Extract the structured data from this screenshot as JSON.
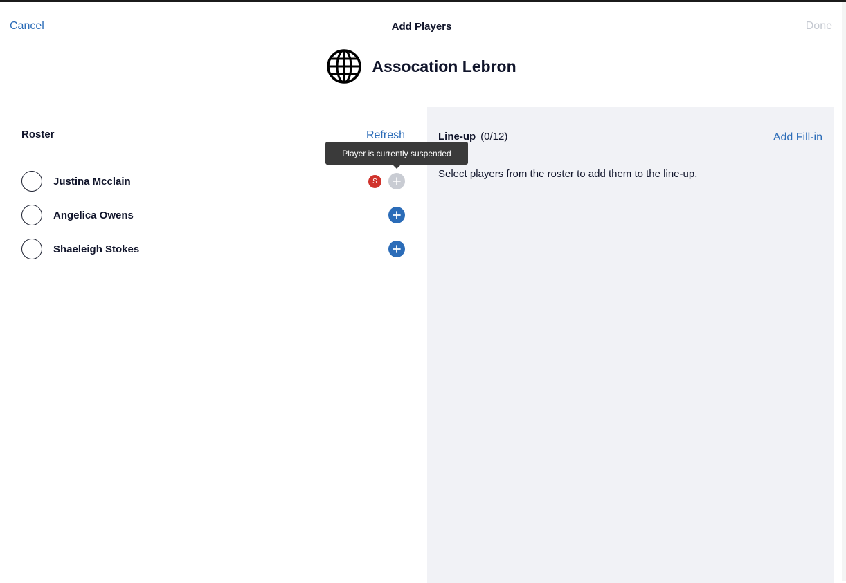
{
  "header": {
    "cancel_label": "Cancel",
    "title": "Add Players",
    "done_label": "Done"
  },
  "team": {
    "name": "Assocation Lebron",
    "icon": "globe-icon"
  },
  "roster": {
    "title": "Roster",
    "refresh_label": "Refresh",
    "players": [
      {
        "name": "Justina Mcclain",
        "status_badge": "S",
        "add_disabled": true
      },
      {
        "name": "Angelica Owens",
        "add_disabled": false
      },
      {
        "name": "Shaeleigh Stokes",
        "add_disabled": false
      }
    ]
  },
  "tooltip": {
    "text": "Player is currently suspended"
  },
  "lineup": {
    "title": "Line-up",
    "count": "(0/12)",
    "add_fillin_label": "Add Fill-in",
    "help_text": "Select players from the roster to add them to the line-up."
  },
  "colors": {
    "accent": "#2b6cb8",
    "suspended": "#d0332c",
    "disabled": "#c9ccd3",
    "panel": "#f1f2f6"
  }
}
